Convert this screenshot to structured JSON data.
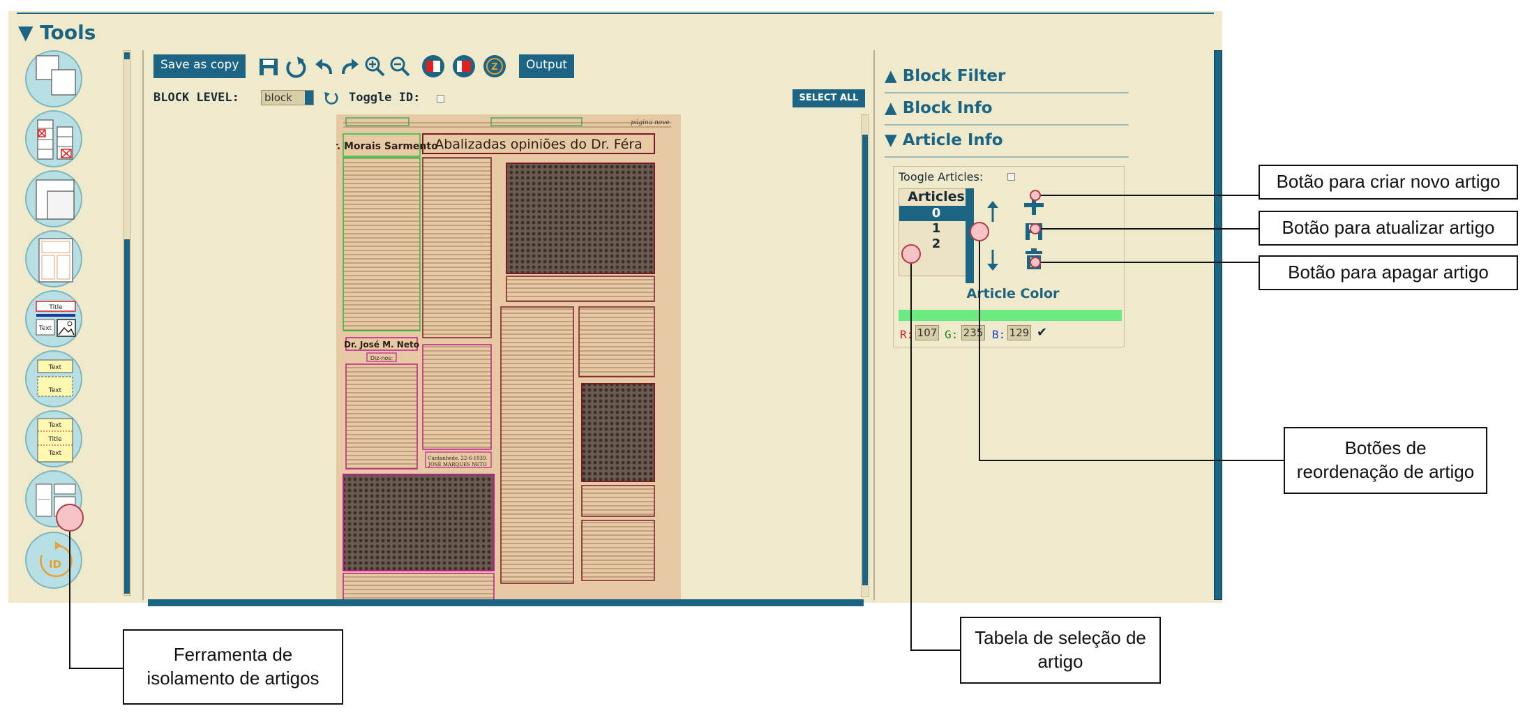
{
  "app": {
    "tools_title": "▼ Tools",
    "toolbar": {
      "save_as_copy": "Save as copy",
      "output": "Output",
      "block_level_label": "BLOCK LEVEL:",
      "block_level_value": "block",
      "toggle_id_label": "Toggle ID:",
      "select_all": "SELECT ALL"
    },
    "tool_icons": [
      "tool-1",
      "tool-2",
      "tool-3",
      "tool-4",
      "tool-5",
      "tool-6",
      "tool-7",
      "article-isolation-tool",
      "tool-id"
    ],
    "tool_texts": {
      "title": "Title",
      "text": "Text"
    },
    "right_panel": {
      "block_filter": "▲ Block Filter",
      "block_info": "▲ Block Info",
      "article_info": "▼ Article Info",
      "toggle_articles_label": "Toogle Articles:",
      "articles_header": "Articles",
      "articles": [
        "0",
        "1",
        "2"
      ],
      "selected_article": "0",
      "article_color_label": "Article Color",
      "article_color": "#6beb81",
      "r_label": "R:",
      "g_label": "G:",
      "b_label": "B:",
      "r_value": "107",
      "g_value": "235",
      "b_value": "129",
      "confirm": "✔"
    },
    "document": {
      "headline": "Abalizadas opiniões do Dr. Féra",
      "side_title": "Dr. Morais Sarmento",
      "second_title": "Dr. José M. Neto",
      "small_label": "Diz-nos:",
      "date_line": "Cantanhede, 22-6-1939.",
      "signature": "JOSÉ MARQUES NETO",
      "page_label": "página nove"
    }
  },
  "colors": {
    "accent": "#1c6484",
    "panel_bg": "#eeeacb",
    "paper": "#e7c9a3"
  },
  "annotations": {
    "new_article": "Botão para criar novo artigo",
    "update_article": "Botão para atualizar artigo",
    "delete_article": "Botão para apagar artigo",
    "reorder_line1": "Botões de",
    "reorder_line2": "reordenação de artigo",
    "selection_line1": "Tabela de seleção de",
    "selection_line2": "artigo",
    "isolation_line1": "Ferramenta de",
    "isolation_line2": "isolamento de artigos"
  }
}
